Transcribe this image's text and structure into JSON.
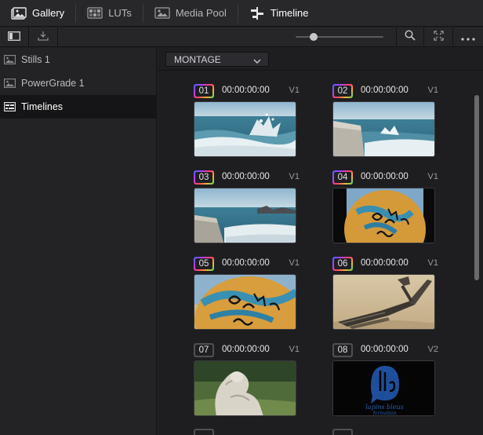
{
  "tabs": [
    {
      "label": "Gallery",
      "icon": "gallery-icon",
      "active": true
    },
    {
      "label": "LUTs",
      "icon": "luts-icon",
      "active": false
    },
    {
      "label": "Media Pool",
      "icon": "media-pool-icon",
      "active": false
    },
    {
      "label": "Timeline",
      "icon": "timeline-icon",
      "active": true
    }
  ],
  "toolbar": {
    "left_icons": [
      "panel-toggle-icon",
      "import-icon"
    ],
    "right_icons": [
      "search-icon",
      "expand-icon",
      "more-icon"
    ],
    "zoom_level": 0.2
  },
  "sidebar": {
    "items": [
      {
        "label": "Stills 1",
        "icon": "stills-icon",
        "selected": false
      },
      {
        "label": "PowerGrade 1",
        "icon": "powergrade-icon",
        "selected": false
      },
      {
        "label": "Timelines",
        "icon": "timelines-icon",
        "selected": true
      }
    ]
  },
  "timeline_select": {
    "value": "MONTAGE"
  },
  "clips": [
    {
      "number": "01",
      "timecode": "00:00:00:00",
      "track": "V1",
      "thumb": "sea-splash"
    },
    {
      "number": "02",
      "timecode": "00:00:00:00",
      "track": "V1",
      "thumb": "sea-wall"
    },
    {
      "number": "03",
      "timecode": "00:00:00:00",
      "track": "V1",
      "thumb": "sea-rocks"
    },
    {
      "number": "04",
      "timecode": "00:00:00:00",
      "track": "V1",
      "thumb": "graffiti-bunker-dark"
    },
    {
      "number": "05",
      "timecode": "00:00:00:00",
      "track": "V1",
      "thumb": "graffiti-bunker"
    },
    {
      "number": "06",
      "timecode": "00:00:00:00",
      "track": "V1",
      "thumb": "driftwood-beach"
    },
    {
      "number": "07",
      "timecode": "00:00:00:00",
      "track": "V1",
      "thumb": "stone-sculpture"
    },
    {
      "number": "08",
      "timecode": "00:00:00:00",
      "track": "V2",
      "thumb": "lapins-bleus-logo"
    }
  ],
  "logo": {
    "line1": "lapins bleus",
    "line2": "formation"
  },
  "colors": {
    "accent_blue": "#1f4f9c",
    "badge_gradient": [
      "#3c6cff",
      "#b040ff",
      "#ff4070",
      "#ffb030",
      "#40e070"
    ]
  }
}
